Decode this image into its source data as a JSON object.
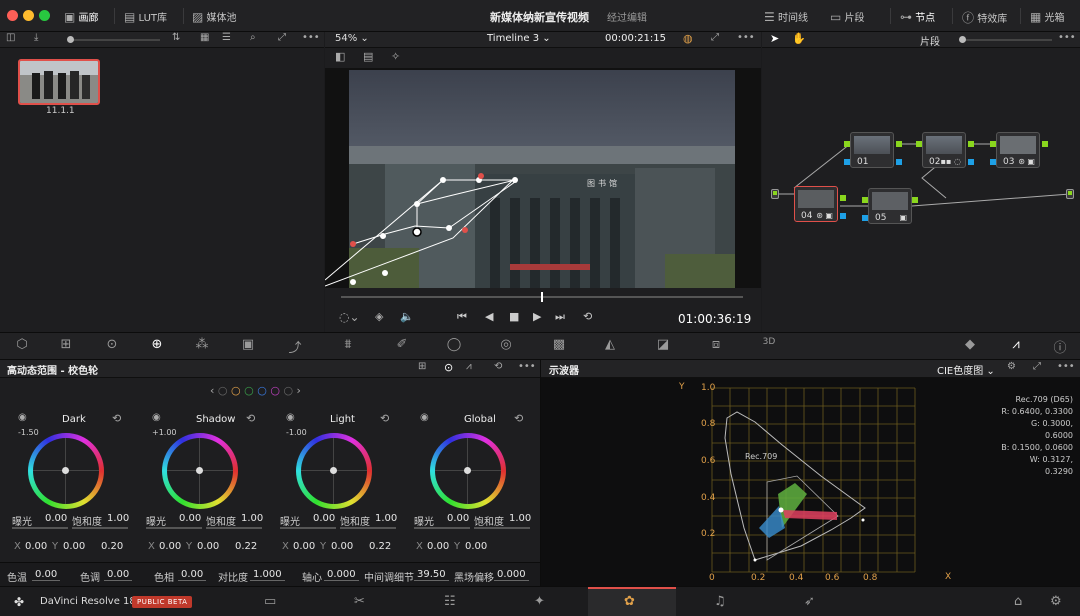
{
  "topbar": {
    "gallery_label": "画廊",
    "lut_label": "LUT库",
    "mediapool_label": "媒体池",
    "project_title": "新媒体纳新宣传视频",
    "project_status": "经过编辑",
    "timeline_label": "时间线",
    "clips_label": "片段",
    "nodes_label": "节点",
    "effects_label": "特效库",
    "lightbox_label": "光箱"
  },
  "viewer": {
    "zoom": "54%",
    "timeline_name": "Timeline 3",
    "timecode_top": "00:00:21:15",
    "timecode_bottom": "01:00:36:19",
    "building_sign": "图书馆"
  },
  "gallery": {
    "clip_label": "11.1.1"
  },
  "nodes_panel": {
    "mode_label": "片段",
    "nodes": [
      {
        "id": "01",
        "icons": ""
      },
      {
        "id": "02",
        "icons": "▪▪ ◌"
      },
      {
        "id": "03",
        "icons": "⊛ ▣"
      },
      {
        "id": "04",
        "icons": "⊛ ▣"
      },
      {
        "id": "05",
        "icons": "▣"
      }
    ]
  },
  "color_panel": {
    "title": "高动态范围 - 校色轮",
    "wheels": [
      {
        "name": "Dark",
        "top_value": "-1.50",
        "exposure": "0.00",
        "saturation": "1.00",
        "x": "0.00",
        "y": "0.00",
        "z": "0.20"
      },
      {
        "name": "Shadow",
        "top_value": "+1.00",
        "exposure": "0.00",
        "saturation": "1.00",
        "x": "0.00",
        "y": "0.00",
        "z": "0.22"
      },
      {
        "name": "Light",
        "top_value": "-1.00",
        "exposure": "0.00",
        "saturation": "1.00",
        "x": "0.00",
        "y": "0.00",
        "z": "0.22"
      },
      {
        "name": "Global",
        "top_value": "",
        "exposure": "0.00",
        "saturation": "1.00",
        "x": "0.00",
        "y": "0.00",
        "z": ""
      }
    ],
    "exposure_label": "曝光",
    "saturation_label": "饱和度",
    "bottom": {
      "temp_label": "色温",
      "temp": "0.00",
      "tint_label": "色调",
      "tint": "0.00",
      "hue_label": "色相",
      "hue": "0.00",
      "contrast_label": "对比度",
      "contrast": "1.000",
      "pivot_label": "轴心",
      "pivot": "0.000",
      "middetail_label": "中间调细节",
      "middetail": "39.50",
      "blackoffset_label": "黑场偏移",
      "blackoffset": "0.000"
    }
  },
  "scope": {
    "title": "示波器",
    "mode": "CIE色度图",
    "info": {
      "line1": "Rec.709 (D65)",
      "line2": "R: 0.6400, 0.3300",
      "line3": "G: 0.3000, 0.6000",
      "line4": "B: 0.1500, 0.0600",
      "line5": "W: 0.3127, 0.3290"
    },
    "rec_label": "Rec.709",
    "axis_x": "X",
    "axis_y": "Y",
    "ticks_y": [
      "1.0",
      "0.8",
      "0.6",
      "0.4",
      "0.2"
    ],
    "ticks_x": [
      "0",
      "0.2",
      "0.4",
      "0.6",
      "0.8"
    ]
  },
  "footer": {
    "app_name": "DaVinci Resolve 18",
    "badge": "PUBLIC BETA"
  },
  "colors": {
    "accent_red": "#e0504a",
    "node_green": "#8ad61e",
    "node_blue": "#1ea0e6",
    "scope_grid": "#6b5a1e"
  }
}
